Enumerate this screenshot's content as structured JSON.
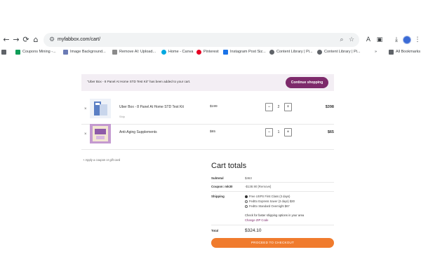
{
  "browser": {
    "url": "myfabbox.com/cart/",
    "icons": [
      "back-icon",
      "forward-icon",
      "reload-icon",
      "home-icon",
      "site-settings-icon",
      "zoom-icon",
      "star-icon",
      "read-aloud-icon",
      "extensions-icon",
      "downloads-icon",
      "menu-icon",
      "profile-icon"
    ],
    "bookmarks": [
      {
        "label": "Coupons Mining -...",
        "icon_color": "#0f9d58"
      },
      {
        "label": "Image Background...",
        "icon_color": "#6b7bb5"
      },
      {
        "label": "Remove AI: Upload...",
        "icon_color": "#8a8a8a"
      },
      {
        "label": "Home - Canva",
        "icon_color": "#00a8e0"
      },
      {
        "label": "Pinterest",
        "icon_color": "#e60023"
      },
      {
        "label": "Instagram Post Siz...",
        "icon_color": "#1a73e8"
      },
      {
        "label": "Content Library | Pi...",
        "icon_color": "#5f6368"
      },
      {
        "label": "Content Library | Pi...",
        "icon_color": "#5f6368"
      }
    ],
    "all_bookmarks": "All Bookmarks"
  },
  "notice": {
    "message": "\"Uber Box - 8 Panel At Home STD Test Kit\" has been added to your cart.",
    "button": "Continue shopping",
    "accent": "#7d2a6b"
  },
  "cart": {
    "items": [
      {
        "name": "Uber Box - 8 Panel At Home STD Test Kit",
        "sub": "Ship",
        "price": "$199",
        "qty": "2",
        "total": "$398"
      },
      {
        "name": "Anti-Aging Supplements",
        "sub": "",
        "price": "$65",
        "qty": "1",
        "total": "$65"
      }
    ],
    "minus": "−",
    "plus": "+",
    "remove": "×"
  },
  "coupon_link": "+ Apply a coupon or gift card",
  "totals": {
    "title": "Cart totals",
    "subtotal_label": "Subtotal",
    "subtotal_value": "$463",
    "coupon_label": "Coupon: mk30",
    "coupon_value": "-$138.90 [Remove]",
    "shipping_label": "Shipping",
    "shipping_options": [
      {
        "label": "Free USPS First Class (3 days)",
        "selected": true
      },
      {
        "label": "FedEx Express Saver (3 days) $30",
        "selected": false
      },
      {
        "label": "FedEx Standard Overnight $67",
        "selected": false
      }
    ],
    "shipping_note": "Check for faster shipping options in your area",
    "change_zip": "Change ZIP Code",
    "total_label": "Total",
    "total_value": "$324.10",
    "checkout_button": "PROCEED TO CHECKOUT",
    "checkout_color": "#f07b2d"
  }
}
